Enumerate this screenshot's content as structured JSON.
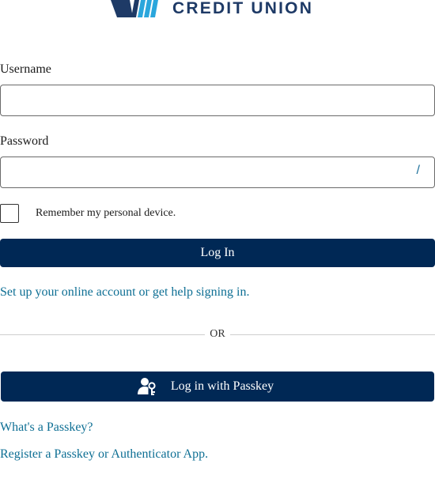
{
  "brand": {
    "name": "CREDIT UNION",
    "primary_color": "#002855",
    "link_color": "#0e6f94"
  },
  "form": {
    "username_label": "Username",
    "username_value": "",
    "password_label": "Password",
    "password_value": "",
    "password_toggle_icon": "show-password-icon",
    "password_toggle_glyph": "/",
    "remember_label": "Remember my personal device.",
    "remember_checked": false,
    "login_button": "Log In"
  },
  "links": {
    "setup_help": "Set up your online account or get help signing in.",
    "whats_passkey": "What's a Passkey?",
    "register_passkey": "Register a Passkey or Authenticator App."
  },
  "divider_text": "OR",
  "passkey_button": {
    "label": "Log in with Passkey",
    "icon": "user-key-icon"
  }
}
